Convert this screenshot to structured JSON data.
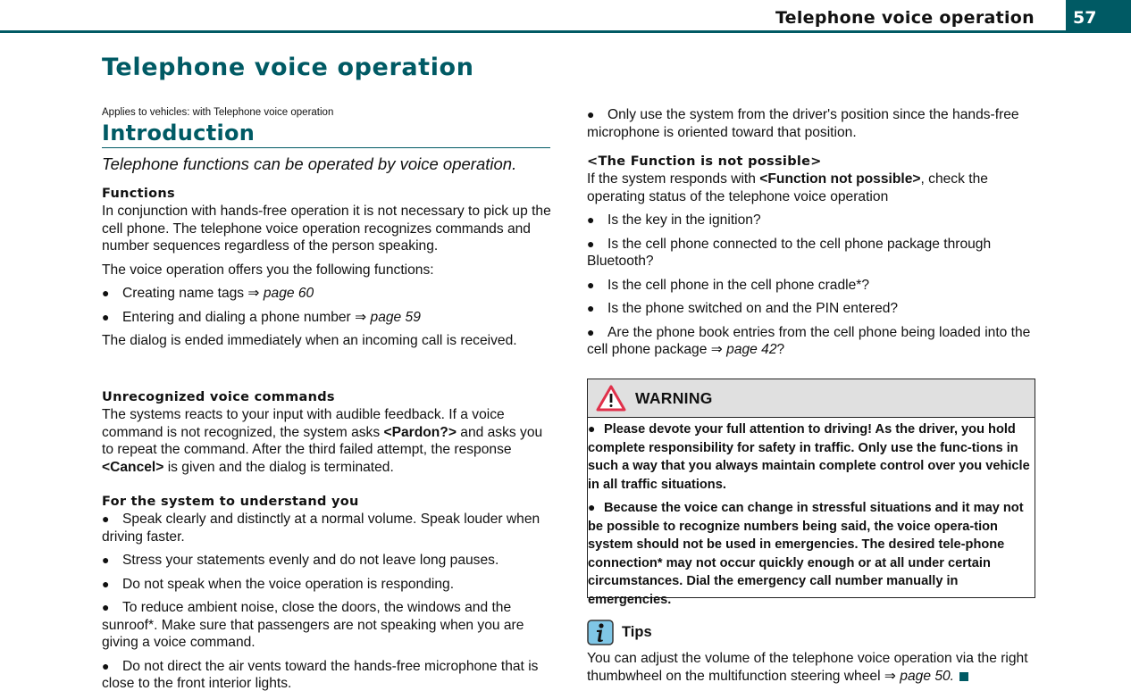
{
  "header": {
    "running_title": "Telephone voice operation",
    "page_number": "57",
    "accent_color": "#005a64"
  },
  "chapter_title": "Telephone voice operation",
  "applies_to": "Applies to vehicles: with Telephone voice operation",
  "section": {
    "title": "Introduction",
    "lead": "Telephone functions can be operated by voice operation."
  },
  "functions": {
    "heading": "Functions",
    "para1": "In conjunction with hands-free operation it is not necessary to pick up the cell phone. The telephone voice operation recognizes commands and number sequences regardless of the person speaking.",
    "para2": "The voice operation offers you the following functions:",
    "items": [
      {
        "text": "Creating name tags ",
        "arrow": "⇒",
        "ref": "page 60"
      },
      {
        "text": "Entering and dialing a phone number ",
        "arrow": "⇒",
        "ref": "page 59"
      }
    ],
    "para3": "The dialog is ended immediately when an incoming call is received."
  },
  "unrecognized": {
    "heading": "Unrecognized voice commands",
    "text_a": "The systems reacts to your input with audible feedback. If a voice command is not recognized, the system asks ",
    "bold_a": "<Pardon?>",
    "text_b": " and asks you to repeat the command. After the third failed attempt, the response ",
    "bold_b": "<Cancel>",
    "text_c": " is given and the dialog is terminated."
  },
  "understand": {
    "heading": "For the system to understand you",
    "items": [
      "Speak clearly and distinctly at a normal volume. Speak louder when driving faster.",
      "Stress your statements evenly and do not leave long pauses.",
      "Do not speak when the voice operation is responding.",
      "To reduce ambient noise, close the doors, the windows and the sunroof*. Make sure that passengers are not speaking when you are giving a voice command.",
      "Do not direct the air vents toward the hands-free microphone that is close to the front interior lights.",
      "Only use the system from the driver's position since the hands-free microphone is oriented toward that position."
    ]
  },
  "not_possible": {
    "heading": "<The Function is not possible>",
    "text_a": "If the system responds with ",
    "bold_a": "<Function not possible>",
    "text_b": ", check the operating status of the telephone voice operation",
    "items": [
      {
        "text": "Is the key in the ignition?"
      },
      {
        "text": "Is the cell phone connected to the cell phone package through Bluetooth?"
      },
      {
        "text": "Is the cell phone in the cell phone cradle*?"
      },
      {
        "text": "Is the phone switched on and the PIN entered?"
      },
      {
        "text": "Are the phone book entries from the cell phone being loaded into the cell phone package ",
        "arrow": "⇒",
        "ref": "page 42",
        "tail": "?"
      }
    ]
  },
  "warning": {
    "icon": "warning-triangle-icon",
    "label": "WARNING",
    "items": [
      "Please devote your full attention to driving! As the driver, you hold complete responsibility for safety in traffic. Only use the func-tions in such a way that you always maintain complete control over you vehicle in all traffic situations.",
      "Because the voice can change in stressful situations and it may not be possible to recognize numbers being said, the voice opera-tion system should not be used in emergencies. The desired tele-phone connection* may not occur quickly enough or at all under certain circumstances. Dial the emergency call number manually in emergencies."
    ]
  },
  "tips": {
    "icon": "info-icon",
    "label": "Tips",
    "text": "You can adjust the volume of the telephone voice operation via the right thumbwheel on the multifunction steering wheel ",
    "arrow": "⇒",
    "ref": "page 50",
    "tail": "."
  },
  "bullet_glyph": "●"
}
